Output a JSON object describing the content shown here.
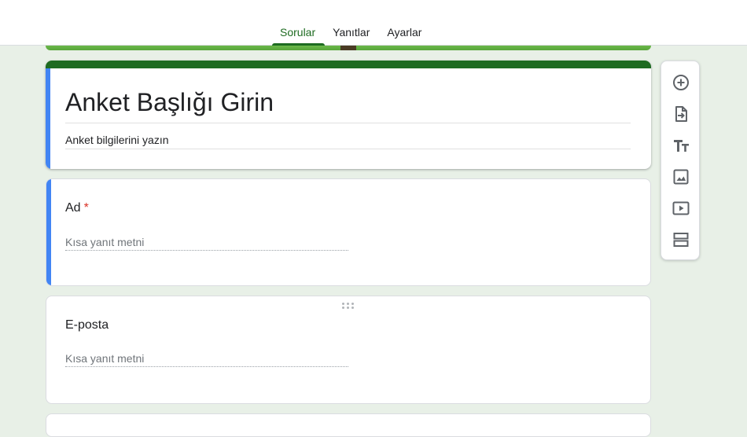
{
  "tabs": [
    {
      "label": "Sorular",
      "active": true
    },
    {
      "label": "Yanıtlar",
      "active": false
    },
    {
      "label": "Ayarlar",
      "active": false
    }
  ],
  "form": {
    "title": "Anket Başlığı Girin",
    "description": "Anket bilgilerini yazın"
  },
  "questions": [
    {
      "title": "Ad",
      "required_mark": "*",
      "answer_placeholder": "Kısa yanıt metni"
    },
    {
      "title": "E-posta",
      "answer_placeholder": "Kısa yanıt metni"
    }
  ],
  "toolbar": {
    "tools": [
      "add-question-icon",
      "import-questions-icon",
      "add-title-icon",
      "add-image-icon",
      "add-video-icon",
      "add-section-icon"
    ]
  },
  "colors": {
    "accent": "#1e6b21",
    "active_indicator": "#4285f4",
    "required": "#d93025",
    "background": "#e8f0e7"
  }
}
